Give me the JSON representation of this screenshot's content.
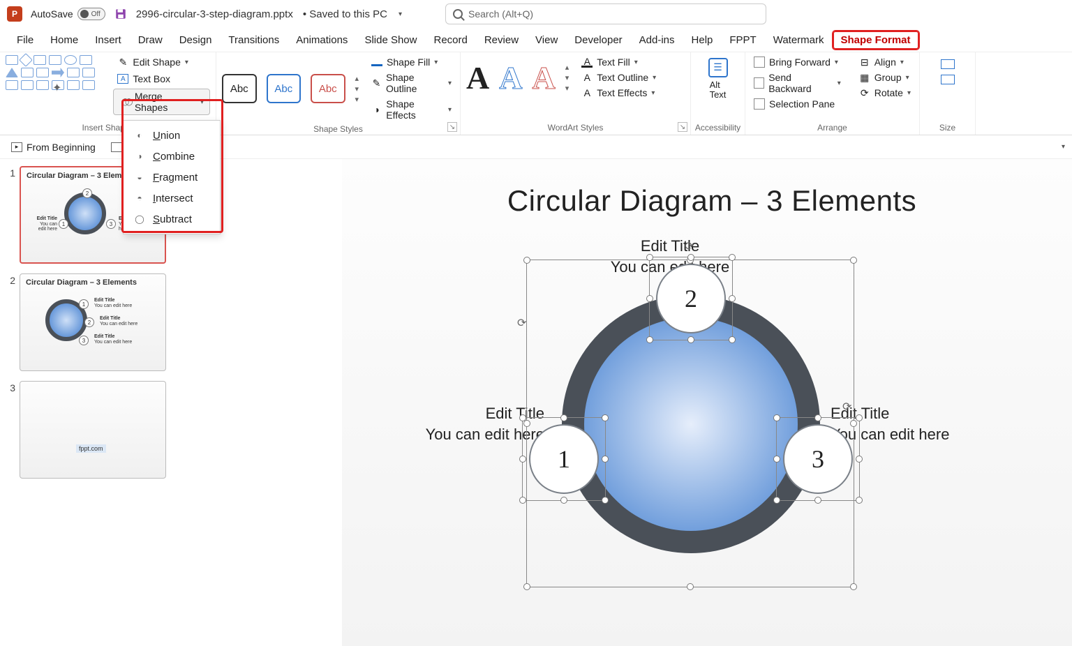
{
  "titlebar": {
    "autosave_label": "AutoSave",
    "autosave_state": "Off",
    "filename": "2996-circular-3-step-diagram.pptx",
    "status": "• Saved to this PC",
    "search_placeholder": "Search (Alt+Q)"
  },
  "tabs": [
    "File",
    "Home",
    "Insert",
    "Draw",
    "Design",
    "Transitions",
    "Animations",
    "Slide Show",
    "Record",
    "Review",
    "View",
    "Developer",
    "Add-ins",
    "Help",
    "FPPT",
    "Watermark",
    "Shape Format"
  ],
  "active_tab": "Shape Format",
  "ribbon": {
    "insert_shapes": {
      "label": "Insert Shapes",
      "edit_shape": "Edit Shape",
      "text_box": "Text Box",
      "merge_shapes": "Merge Shapes",
      "merge_menu": [
        "Union",
        "Combine",
        "Fragment",
        "Intersect",
        "Subtract"
      ]
    },
    "shape_styles": {
      "label": "Shape Styles",
      "abc": "Abc",
      "shape_fill": "Shape Fill",
      "shape_outline": "Shape Outline",
      "shape_effects": "Shape Effects"
    },
    "wordart_styles": {
      "label": "WordArt Styles",
      "text_fill": "Text Fill",
      "text_outline": "Text Outline",
      "text_effects": "Text Effects"
    },
    "accessibility": {
      "label": "Accessibility",
      "alt_text": "Alt\nText"
    },
    "arrange": {
      "label": "Arrange",
      "bring_forward": "Bring Forward",
      "send_backward": "Send Backward",
      "selection_pane": "Selection Pane",
      "align": "Align",
      "group": "Group",
      "rotate": "Rotate"
    },
    "size": {
      "label": "Size"
    }
  },
  "quickrow": {
    "from_beginning": "From Beginning"
  },
  "slides": {
    "s1": {
      "title": "Circular Diagram – 3 Elements",
      "edit_title": "Edit Title",
      "edit_sub": "You can edit here",
      "n1": "1",
      "n2": "2",
      "n3": "3"
    },
    "s2": {
      "title": "Circular Diagram – 3 Elements",
      "edit_title": "Edit Title",
      "edit_sub": "You can edit here",
      "n1": "1",
      "n2": "2",
      "n3": "3"
    },
    "s3": {
      "footer": "fppt.com"
    }
  },
  "main_slide": {
    "title": "Circular Diagram – 3 Elements",
    "top": {
      "t1": "Edit Title",
      "t2": "You can edit here"
    },
    "left": {
      "t1": "Edit Title",
      "t2": "You can edit here"
    },
    "right": {
      "t1": "Edit Title",
      "t2": "You can edit here"
    },
    "n1": "1",
    "n2": "2",
    "n3": "3"
  }
}
